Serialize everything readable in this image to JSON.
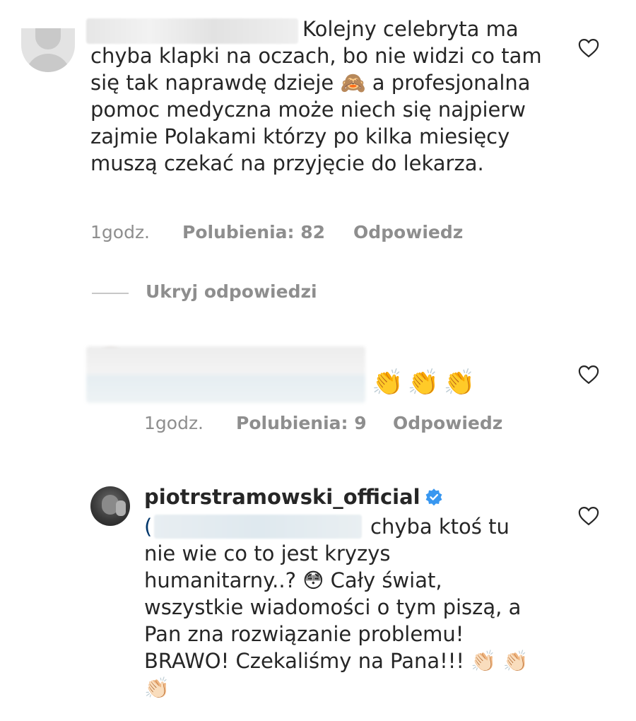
{
  "comments": [
    {
      "text_first_line": "Kolejny celebryta ma",
      "text_rest": "chyba klapki na oczach, bo nie widzi co tam się tak naprawdę dzieje 🙈 a profesjonalna pomoc medyczna może niech się najpierw zajmie Polakami którzy po kilka miesięcy muszą czekać na przyjęcie do lekarza.",
      "time": "1godz.",
      "likes": "Polubienia: 82",
      "reply": "Odpowiedz"
    },
    {
      "emojis": "👏👏👏",
      "time": "1godz.",
      "likes": "Polubienia: 9",
      "reply": "Odpowiedz"
    },
    {
      "username": "piotrstramowski_official",
      "mention_prefix": "(",
      "text_first_line": "chyba ktoś tu",
      "text_rest": "nie wie co to jest kryzys humanitarny..? 😳 Cały świat, wszystkie wiadomości o tym piszą, a Pan zna rozwiązanie problemu! BRAWO! Czekaliśmy na Pana!!! 👏🏻 👏🏻👏🏻"
    }
  ],
  "hide_replies": "Ukryj odpowiedzi",
  "icons": {
    "heart": "heart-outline-icon",
    "verified": "verified-badge-icon"
  },
  "colors": {
    "text": "#262626",
    "meta": "#8e8e8e",
    "verified": "#3897f0"
  }
}
